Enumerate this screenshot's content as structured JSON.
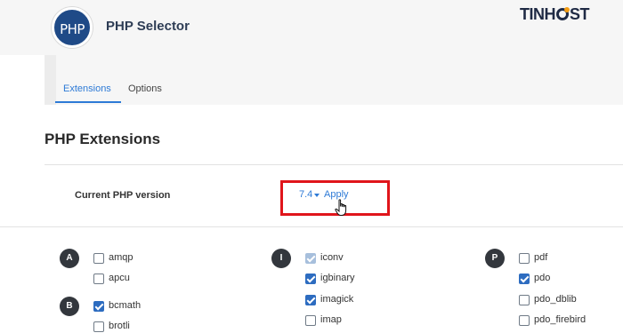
{
  "header": {
    "logo_text": "PHP",
    "title": "PHP Selector",
    "brand_left": "TIN",
    "brand_right": "H",
    "brand_tail": "ST"
  },
  "tabs": [
    {
      "label": "Extensions",
      "active": true
    },
    {
      "label": "Options",
      "active": false
    }
  ],
  "section_title": "PHP Extensions",
  "version": {
    "label": "Current PHP version",
    "value": "7.4",
    "apply_label": "Apply"
  },
  "groups": [
    {
      "letter": "A",
      "items": [
        {
          "name": "amqp",
          "state": "unchecked"
        },
        {
          "name": "apcu",
          "state": "unchecked"
        }
      ]
    },
    {
      "letter": "B",
      "items": [
        {
          "name": "bcmath",
          "state": "checked"
        },
        {
          "name": "brotli",
          "state": "unchecked"
        }
      ]
    },
    {
      "letter": "I",
      "items": [
        {
          "name": "iconv",
          "state": "disabled-checked"
        },
        {
          "name": "igbinary",
          "state": "checked"
        },
        {
          "name": "imagick",
          "state": "checked"
        },
        {
          "name": "imap",
          "state": "unchecked"
        }
      ]
    },
    {
      "letter": "P",
      "items": [
        {
          "name": "pdf",
          "state": "unchecked"
        },
        {
          "name": "pdo",
          "state": "checked"
        },
        {
          "name": "pdo_dblib",
          "state": "unchecked"
        },
        {
          "name": "pdo_firebird",
          "state": "unchecked"
        }
      ]
    }
  ],
  "colors": {
    "accent": "#2d7ad6",
    "checkbox_checked": "#2d6cc0",
    "highlight_box": "#e0151b",
    "badge": "#33373d"
  }
}
